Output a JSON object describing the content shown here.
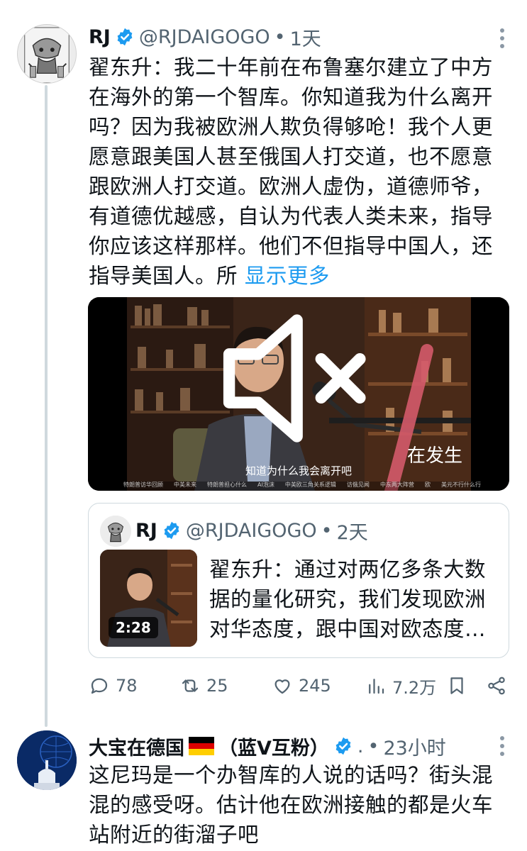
{
  "tweet": {
    "name": "RJ",
    "handle": "@RJDAIGOGO",
    "dot": "•",
    "time": "1天",
    "text": "翟东升：我二十年前在布鲁塞尔建立了中方在海外的第一个智库。你知道我为什么离开吗？因为我被欧洲人欺负得够呛！我个人更愿意跟美国人甚至俄国人打交道，也不愿意跟欧洲人打交道。欧洲人虚伪，道德师爷，有道德优越感，自认为代表人类未来，指导你应该这样那样。他们不但指导中国人，还指导美国人。所 ",
    "show_more": "显示更多",
    "video": {
      "subtitle": "知道为什么我会离开吧",
      "overlay_text": "在发生",
      "chapters": [
        "特朗普访华回顾",
        "中美未来",
        "特朗普担心什么",
        "AI泡沫",
        "中美欧三角关系逻辑",
        "访俄见闻",
        "中东两大阵营",
        "欧",
        "美元不行什么行"
      ]
    },
    "quote": {
      "name": "RJ",
      "handle": "@RJDAIGOGO",
      "dot": "•",
      "time": "2天",
      "duration": "2:28",
      "text": "翟东升：通过对两亿多条大数据的量化研究，我们发现欧洲对华态度，跟中国对欧态度…"
    },
    "actions": {
      "replies": "78",
      "retweets": "25",
      "likes": "245",
      "views": "7.2万"
    }
  },
  "reply": {
    "name_prefix": "大宝在德国",
    "name_suffix": "（蓝V互粉）",
    "handle": ".",
    "dot": "•",
    "time": "23小时",
    "text": "这尼玛是一个办智库的人说的话吗？街头混混的感受呀。估计他在欧洲接触的都是火车站附近的街溜子吧"
  },
  "colors": {
    "accent": "#1d9bf0",
    "secondary_text": "#536471",
    "primary_text": "#0f1419",
    "border": "#cfd9de"
  },
  "icons": [
    "verified-badge-icon",
    "more-icon",
    "mute-icon",
    "reply-icon",
    "retweet-icon",
    "like-icon",
    "views-icon",
    "bookmark-icon",
    "share-icon",
    "germany-flag-icon"
  ]
}
